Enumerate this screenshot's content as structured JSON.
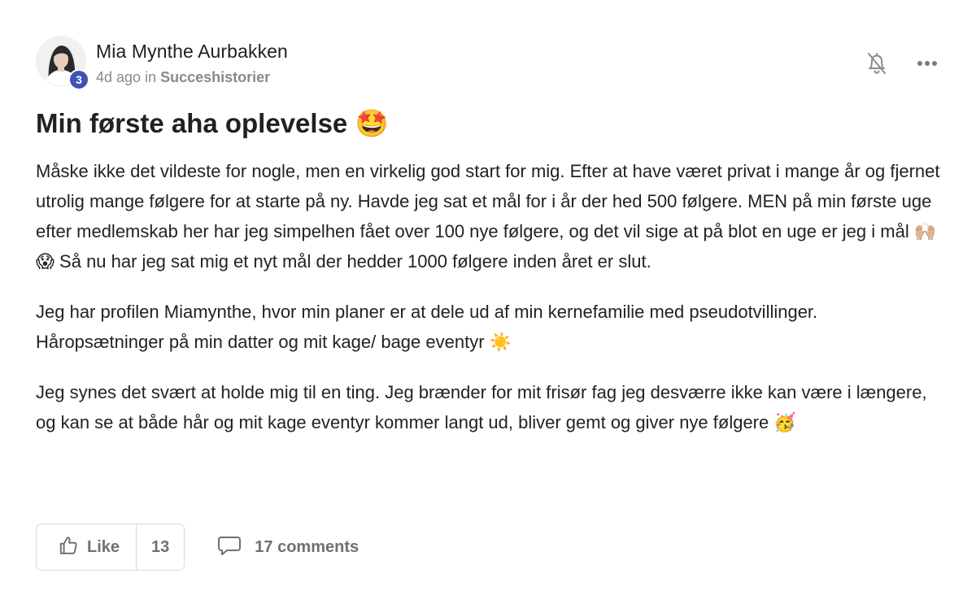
{
  "post": {
    "author_name": "Mia Mynthe Aurbakken",
    "level": "3",
    "time_ago": "4d ago",
    "in_word": "in",
    "category": "Succeshistorier",
    "title": "Min første aha oplevelse",
    "title_emoji": "🤩",
    "paragraphs": [
      "Måske ikke det vildeste for nogle, men en virkelig god start for mig. Efter at have været privat i mange år og fjernet utrolig mange følgere for at starte på ny. Havde jeg sat et mål for i år der hed 500 følgere. MEN på min første uge efter medlemskab her har jeg simpelhen fået over 100 nye følgere, og det vil sige at på blot en uge er jeg i mål 🙌🏼😱 Så nu har jeg sat mig et nyt mål der hedder 1000 følgere inden året er slut.",
      "Jeg har profilen Miamynthe, hvor min planer er at dele ud af min kernefamilie med pseudotvillinger. Håropsætninger på min datter og mit kage/ bage eventyr ☀️",
      "Jeg synes det svært at holde mig til en ting. Jeg brænder for mit frisør fag jeg desværre ikke kan være i længere, og kan se at både hår og mit kage eventyr kommer langt ud, bliver gemt og giver nye følgere 🥳"
    ]
  },
  "actions": {
    "bell_icon": "bell-off-icon",
    "more_icon": "more-horizontal-icon"
  },
  "footer": {
    "like_label": "Like",
    "like_count": "13",
    "comments_label": "17 comments",
    "like_icon": "thumbs-up-icon",
    "comment_icon": "comment-icon"
  },
  "colors": {
    "badge": "#3f51b5",
    "muted_text": "#707070",
    "border": "#d9d9d9"
  }
}
